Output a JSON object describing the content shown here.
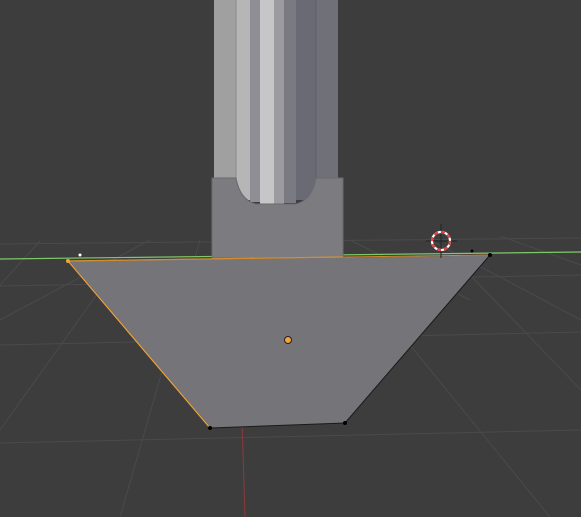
{
  "viewport": {
    "view": "3d-viewport",
    "mode": "edit-mode",
    "background_color": "#3d3d3d",
    "grid_color": "#4a4a4a",
    "x_axis_color": "#7ec86a",
    "z_axis_color": "#8a3a3a"
  },
  "objects": [
    {
      "name": "column-shaft",
      "colors": [
        "#a0a0a0",
        "#b8b8b8",
        "#c4c4c4",
        "#8c8c90",
        "#6a6a72",
        "#7a7a82"
      ]
    },
    {
      "name": "shaft-collar",
      "color": "#7c7b80"
    },
    {
      "name": "tapered-base",
      "color": "#757478",
      "selected_edge_color": "#f2a33a",
      "vertex_color": "#000000"
    }
  ],
  "overlays": {
    "origin_dot_color": "#f2a33a",
    "cursor_ring_colors": [
      "#e04040",
      "#ffffff"
    ]
  }
}
